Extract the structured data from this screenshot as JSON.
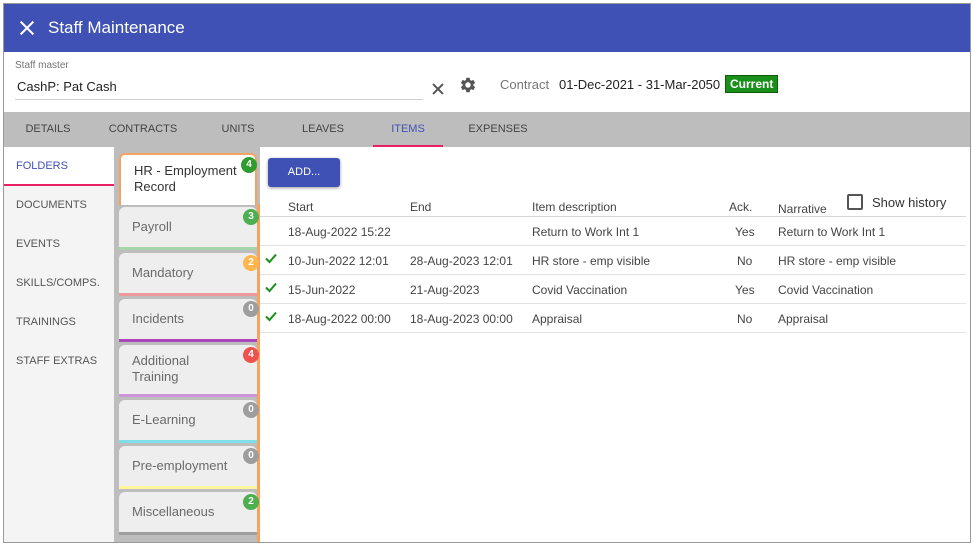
{
  "title": "Staff Maintenance",
  "staff": {
    "label": "Staff master",
    "value": "CashP: Pat Cash"
  },
  "contract": {
    "label": "Contract",
    "dates": "01-Dec-2021 - 31-Mar-2050",
    "status": "Current",
    "status_color": "#1a8f1a"
  },
  "tabs": [
    "DETAILS",
    "CONTRACTS",
    "UNITS",
    "LEAVES",
    "ITEMS",
    "EXPENSES"
  ],
  "active_tab": "ITEMS",
  "sidenav": [
    "FOLDERS",
    "DOCUMENTS",
    "EVENTS",
    "SKILLS/COMPS.",
    "TRAININGS",
    "STAFF EXTRAS"
  ],
  "folders": [
    {
      "label": "HR - Employment Record",
      "count": "4",
      "color": "#2e9b2e",
      "accent": "#f4a460"
    },
    {
      "label": "Payroll",
      "count": "3",
      "color": "#4caf50",
      "accent": "#a5d6a7"
    },
    {
      "label": "Mandatory",
      "count": "2",
      "color": "#ffb74d",
      "accent": "#ef9a9a"
    },
    {
      "label": "Incidents",
      "count": "0",
      "color": "#9e9e9e",
      "accent": "#ab47bc"
    },
    {
      "label": "Additional Training",
      "count": "4",
      "color": "#ef5350",
      "accent": "#ce93d8"
    },
    {
      "label": "E-Learning",
      "count": "0",
      "color": "#9e9e9e",
      "accent": "#80deea"
    },
    {
      "label": "Pre-employment",
      "count": "0",
      "color": "#9e9e9e",
      "accent": "#fff59d"
    },
    {
      "label": "Miscellaneous",
      "count": "2",
      "color": "#4caf50",
      "accent": "#9e9e9e"
    }
  ],
  "add_button": "ADD...",
  "show_history": "Show history",
  "columns": [
    "Start",
    "End",
    "Item description",
    "Ack.",
    "Narrative"
  ],
  "rows": [
    {
      "check": false,
      "start": "18-Aug-2022 15:22",
      "end": "",
      "desc": "Return to Work Int 1",
      "ack": "Yes",
      "narrative": "Return to Work Int 1"
    },
    {
      "check": true,
      "start": "10-Jun-2022 12:01",
      "end": "28-Aug-2023 12:01",
      "desc": "HR store - emp visible",
      "ack": "No",
      "narrative": "HR store - emp visible"
    },
    {
      "check": true,
      "start": "15-Jun-2022",
      "end": "21-Aug-2023",
      "desc": "Covid Vaccination",
      "ack": "Yes",
      "narrative": "Covid Vaccination"
    },
    {
      "check": true,
      "start": "18-Aug-2022 00:00",
      "end": "18-Aug-2023 00:00",
      "desc": "Appraisal",
      "ack": "No",
      "narrative": "Appraisal"
    }
  ]
}
